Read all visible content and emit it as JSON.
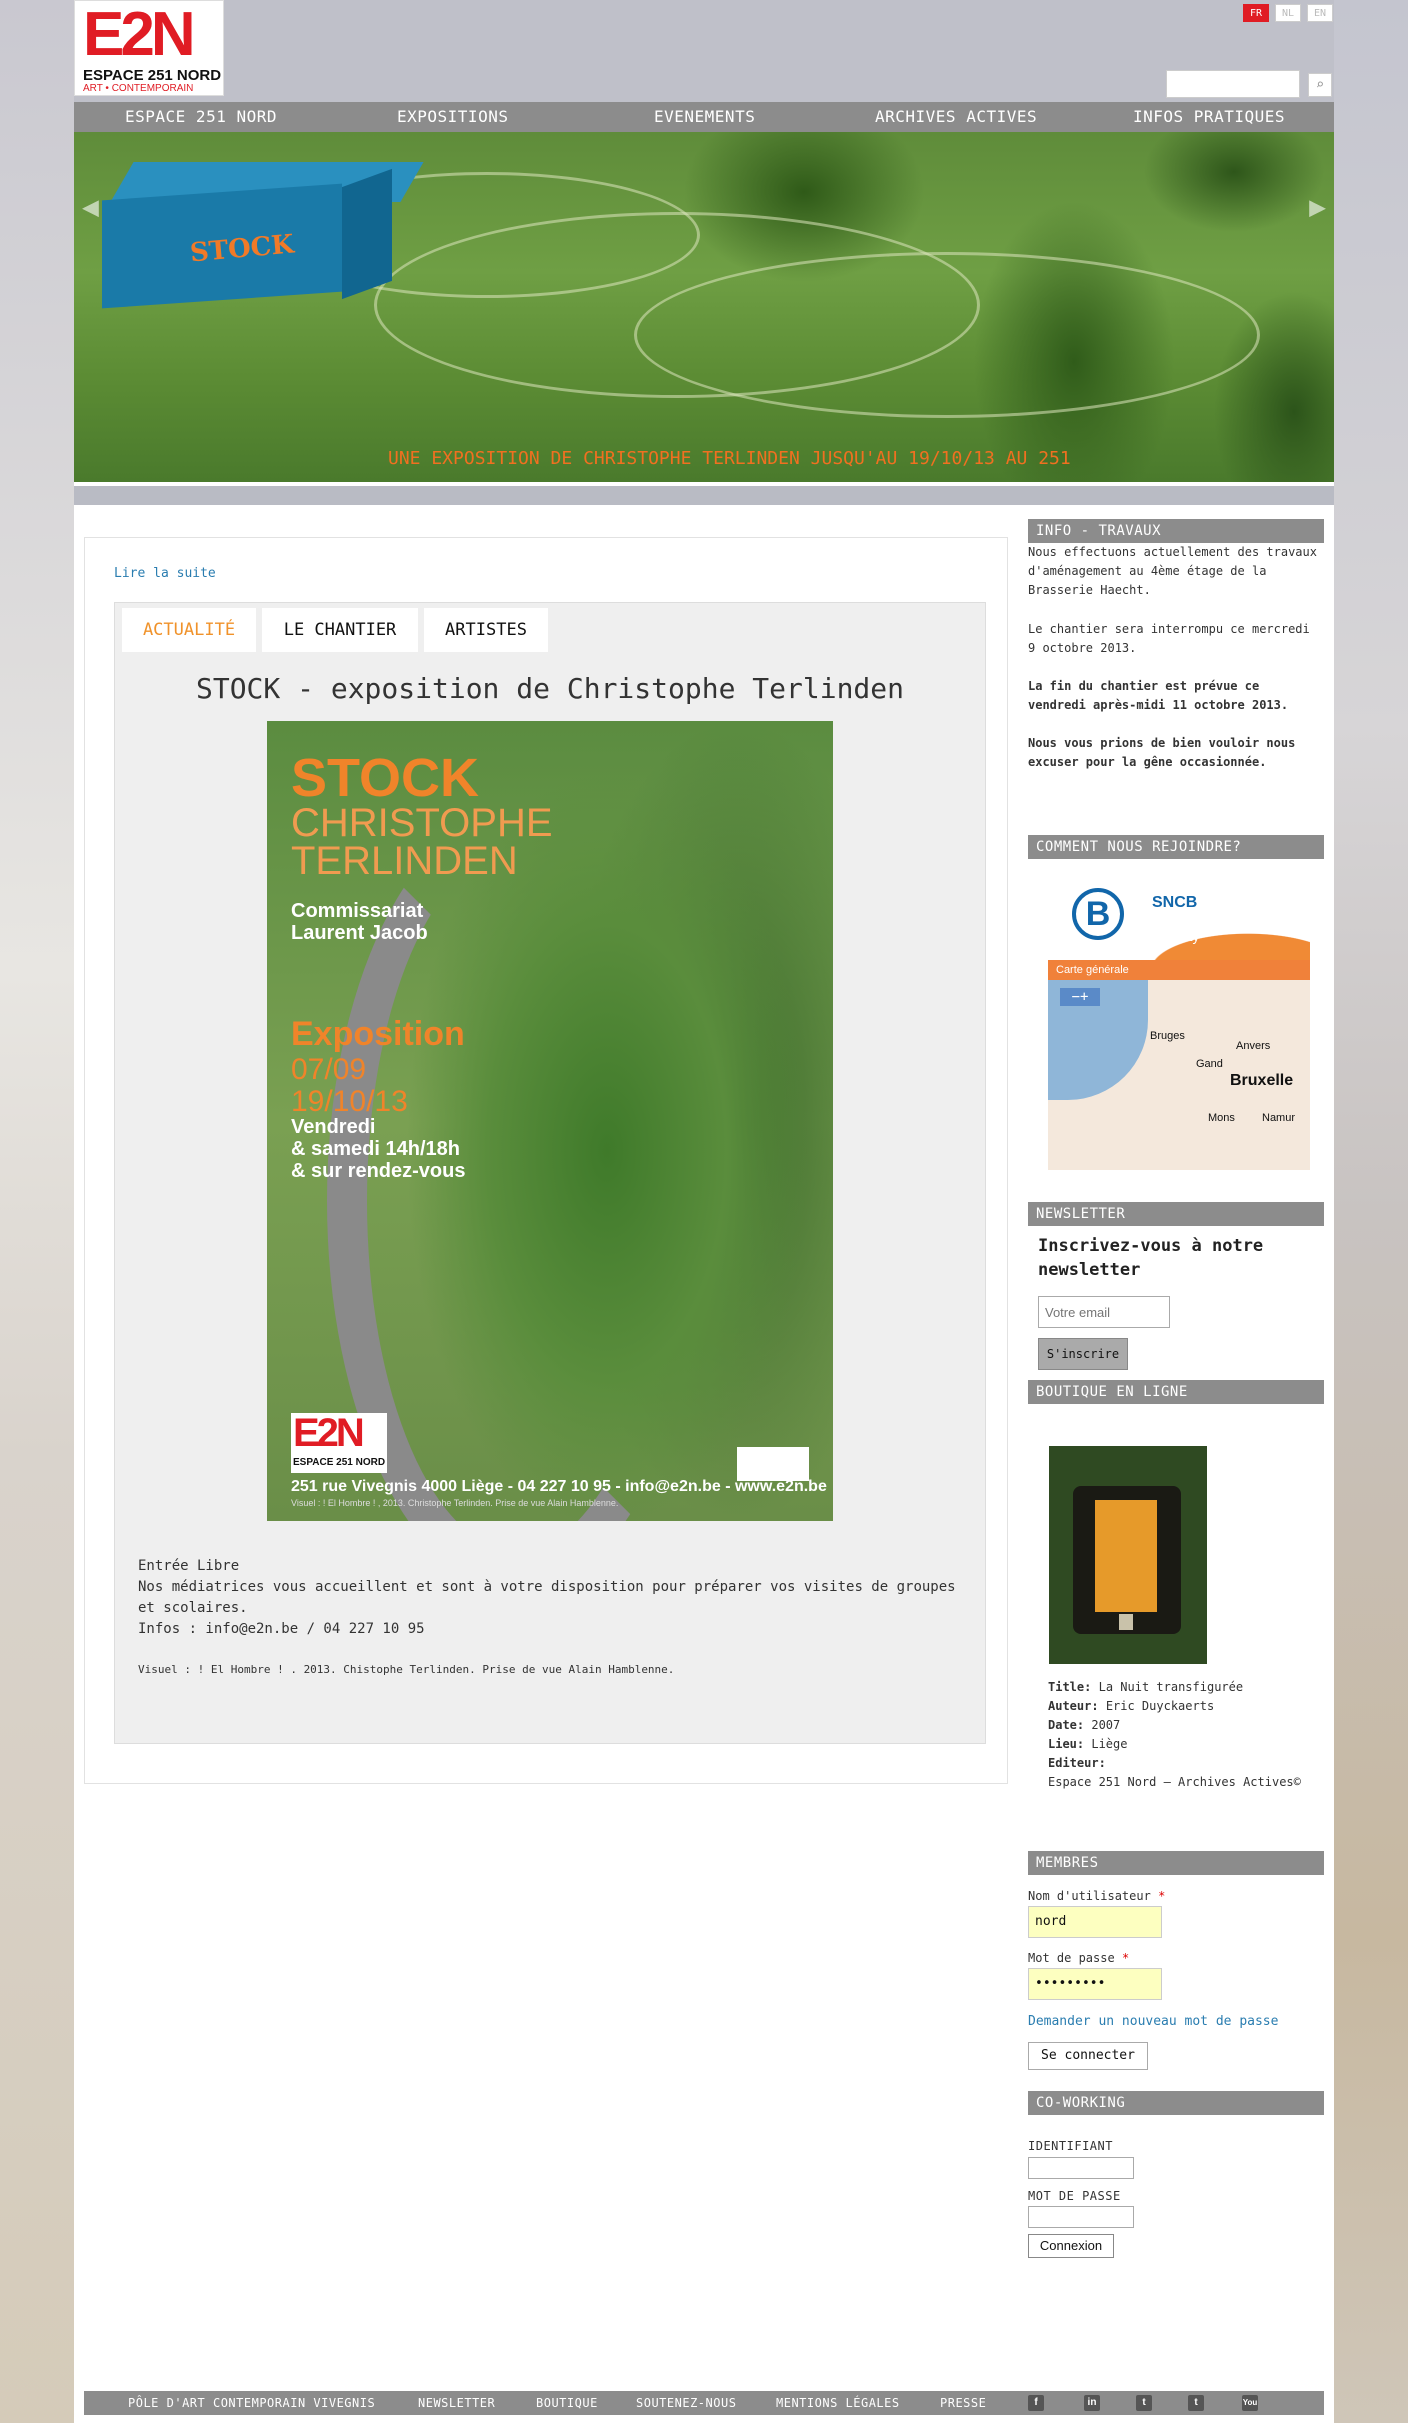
{
  "brand": {
    "logo_text": "E2N",
    "logo_name": "ESPACE 251 NORD",
    "logo_sub": "ART • CONTEMPORAIN"
  },
  "languages": [
    {
      "code": "FR",
      "active": true
    },
    {
      "code": "NL",
      "active": false
    },
    {
      "code": "EN",
      "active": false
    }
  ],
  "search": {
    "placeholder": "",
    "icon": "search-icon"
  },
  "nav": {
    "items": [
      "ESPACE 251 NORD",
      "EXPOSITIONS",
      "EVENEMENTS",
      "ARCHIVES ACTIVES",
      "INFOS PRATIQUES"
    ]
  },
  "banner": {
    "box_label": "STOCK",
    "caption": "UNE EXPOSITION DE CHRISTOPHE TERLINDEN JUSQU'AU 19/10/13 AU 251"
  },
  "main": {
    "read_more": "Lire la suite",
    "tabs": [
      "ACTUALITÉ",
      "LE CHANTIER",
      "ARTISTES"
    ],
    "active_tab": 0,
    "title": "STOCK - exposition de Christophe Terlinden",
    "poster": {
      "title": "STOCK",
      "artist_1": "CHRISTOPHE",
      "artist_2": "TERLINDEN",
      "comm_1": "Commissariat",
      "comm_2": "Laurent Jacob",
      "expo": "Exposition",
      "date_1": "07/09",
      "date_2": "19/10/13",
      "hours_1": "Vendredi",
      "hours_2": "& samedi 14h/18h",
      "hours_3": "& sur rendez-vous",
      "logo": "E2N",
      "logo_name": "ESPACE 251 NORD",
      "address": "251 rue Vivegnis 4000 Liège - 04 227 10 95 - info@e2n.be - www.e2n.be",
      "credit": "Visuel : ! El Hombre ! , 2013. Christophe Terlinden. Prise de vue Alain Hamblenne."
    },
    "entry": "Entrée Libre",
    "description": "Nos médiatrices vous accueillent et sont à votre disposition pour préparer vos visites de groupes et scolaires.",
    "infos": "Infos : info@e2n.be / 04 227 10 95",
    "visual_credit": "Visuel : ! El Hombre ! . 2013. Chistophe Terlinden. Prise de vue Alain Hamblenne."
  },
  "sidebar": {
    "info": {
      "heading": "INFO - TRAVAUX",
      "p1": "Nous effectuons actuellement des travaux d'aménagement au 4ème étage de la Brasserie Haecht.",
      "p2": "Le chantier sera interrompu ce mercredi 9 octobre 2013.",
      "p3": "La fin du chantier est prévue ce vendredi après-midi 11 octobre 2013.",
      "p4": "Nous vous prions de bien vouloir nous excuser pour la gêne occasionnée."
    },
    "join": {
      "heading": "COMMENT NOUS REJOINDRE?",
      "map": {
        "logo": "B",
        "brand": "SNCB",
        "mobility": "Mobility",
        "bar": "Carte générale",
        "zoom": "−+",
        "cities": [
          "Bruges",
          "Anvers",
          "Gand",
          "Bruxelle",
          "Mons",
          "Namur"
        ]
      }
    },
    "newsletter": {
      "heading": "NEWSLETTER",
      "title": "Inscrivez-vous à notre newsletter",
      "placeholder": "Votre email",
      "button": "S'inscrire"
    },
    "shop": {
      "heading": "BOUTIQUE EN LIGNE",
      "title_label": "Title:",
      "title_value": "La Nuit transfigurée",
      "author_label": "Auteur:",
      "author_value": "Eric Duyckaerts",
      "date_label": "Date:",
      "date_value": "2007",
      "place_label": "Lieu:",
      "place_value": "Liège",
      "editor_label": "Editeur:",
      "editor_value": "Espace 251 Nord – Archives Actives©"
    },
    "members": {
      "heading": "MEMBRES",
      "user_label": "Nom d'utilisateur",
      "user_value": "nord",
      "pass_label": "Mot de passe",
      "pass_value": "•••••••••",
      "required": "*",
      "forgot": "Demander un nouveau mot de passe",
      "login": "Se connecter"
    },
    "coworking": {
      "heading": "CO-WORKING",
      "id_label": "IDENTIFIANT",
      "pass_label": "MOT DE PASSE",
      "button": "Connexion"
    }
  },
  "footer": {
    "links": [
      "PÔLE D'ART CONTEMPORAIN VIVEGNIS",
      "NEWSLETTER",
      "BOUTIQUE",
      "SOUTENEZ-NOUS",
      "MENTIONS LÉGALES",
      "PRESSE"
    ],
    "social": [
      {
        "icon": "facebook-icon",
        "glyph": "f"
      },
      {
        "icon": "linkedin-icon",
        "glyph": "in"
      },
      {
        "icon": "tumblr-icon",
        "glyph": "t"
      },
      {
        "icon": "twitter-icon",
        "glyph": "t"
      },
      {
        "icon": "youtube-icon",
        "glyph": "You"
      }
    ]
  },
  "colors": {
    "brand_red": "#e01c24",
    "accent_orange": "#f0922a",
    "nav_grey": "#8c8c8c",
    "link_blue": "#2a7db0"
  }
}
